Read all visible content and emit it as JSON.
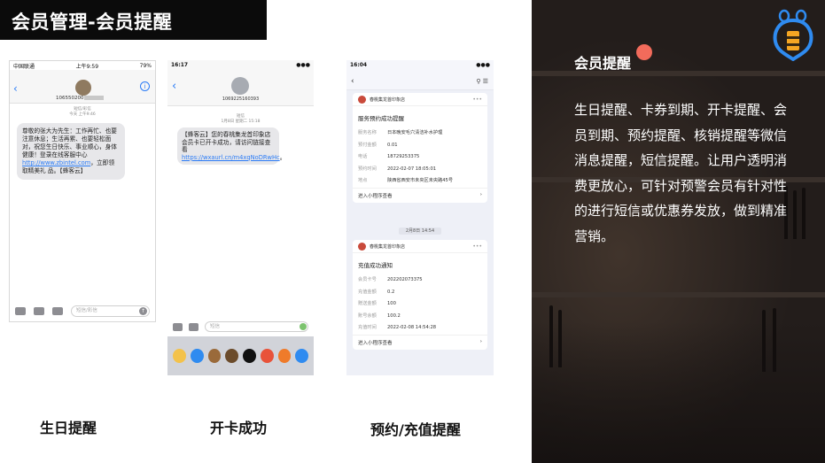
{
  "title": "会员管理-会员提醒",
  "phone1": {
    "status_left": "中国联通",
    "status_time": "上午9:59",
    "status_right": "79%",
    "sender": "106550200",
    "meta_line1": "短信/彩信",
    "meta_line2": "今天 上午9:46",
    "message_pre": "尊敬的张大为先生：工作再忙、也要注意休息；生活再累、也要轻松面对，祝您生日快乐、事业顺心，身体健康！登录在线客服中心",
    "message_link": "http://www.zbintel.com",
    "message_post": "，立即领取精美礼 品。【蜂客云】",
    "input_placeholder": "短信/彩信"
  },
  "phone2": {
    "status_time": "16:17",
    "number": "1069225160393",
    "meta_line1": "短信",
    "meta_line2": "1月8日 星期二 15:18",
    "message_pre": "【蜂客云】您的春桃集龙首印象店会员卡已开卡成功，请访问链接查看",
    "message_link": "https://wxaurl.cn/m4xqNoDRwHc",
    "message_post": "。",
    "input_placeholder": "短信"
  },
  "phone3": {
    "status_time": "16:04",
    "card1": {
      "shop": "春桃集龙首印象店",
      "title": "服务预约成功提醒",
      "rows": [
        {
          "k": "服务名称",
          "v": "日本晚安毛穴清洁补水护理"
        },
        {
          "k": "预付金额",
          "v": "0.01"
        },
        {
          "k": "电话",
          "v": "18729253375"
        },
        {
          "k": "预约时间",
          "v": "2022-02-07 18:05:01"
        },
        {
          "k": "地点",
          "v": "陕西省西安市未央区未央路45号"
        }
      ],
      "footer": "进入小程序查看"
    },
    "divider_time": "2月8日 14:54",
    "card2": {
      "shop": "春桃集龙首印象店",
      "title": "充值成功通知",
      "rows": [
        {
          "k": "会员卡号",
          "v": "202202073375"
        },
        {
          "k": "充值金额",
          "v": "0.2"
        },
        {
          "k": "赠送金额",
          "v": "100"
        },
        {
          "k": "账号余额",
          "v": "100.2"
        },
        {
          "k": "充值时间",
          "v": "2022-02-08 14:54:28"
        }
      ],
      "footer": "进入小程序查看"
    }
  },
  "captions": {
    "c1": "生日提醒",
    "c2": "开卡成功",
    "c3": "预约/充值提醒"
  },
  "right_panel": {
    "heading": "会员提醒",
    "body": "生日提醒、卡券到期、开卡提醒、会员到期、预约提醒、核销提醒等微信消息提醒，短信提醒。让用户透明消费更放心，可针对预警会员有针对性的进行短信或优惠券发放，做到精准营销。",
    "accent_color": "#f26b5b"
  }
}
